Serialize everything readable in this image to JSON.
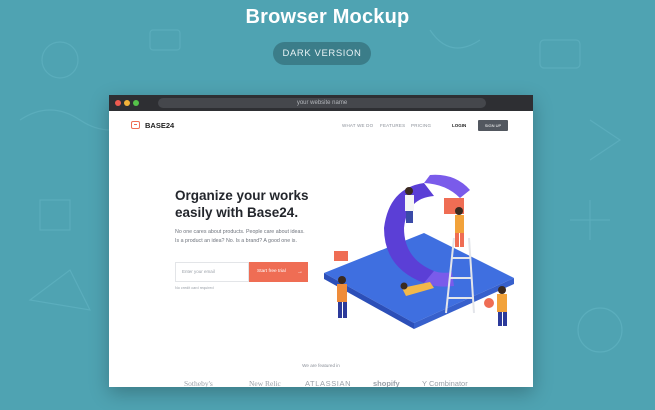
{
  "page": {
    "title": "Browser Mockup",
    "version_button": "DARK VERSION"
  },
  "browser": {
    "url_placeholder": "your website name"
  },
  "site": {
    "brand": "BASE24",
    "nav": [
      "WHAT WE DO",
      "FEATURES",
      "PRICING"
    ],
    "login": "LOGIN",
    "signup": "SIGN UP",
    "headline_line1": "Organize your works",
    "headline_line2": "easily with Base24.",
    "subtext_line1": "No one cares about products. People care about ideas.",
    "subtext_line2": "Is a product an idea? No. Is a brand? A good one is.",
    "email_placeholder": "Enter your email",
    "cta_label": "Start free trial",
    "fine_print": "No credit card required",
    "featured_label": "We are featured in",
    "partners": [
      "Sotheby's",
      "New Relic",
      "ATLASSIAN",
      "shopify",
      "Y Combinator"
    ]
  },
  "colors": {
    "background": "#4fa3b2",
    "accent": "#ef6d54",
    "dark_button": "#3b7d89"
  }
}
